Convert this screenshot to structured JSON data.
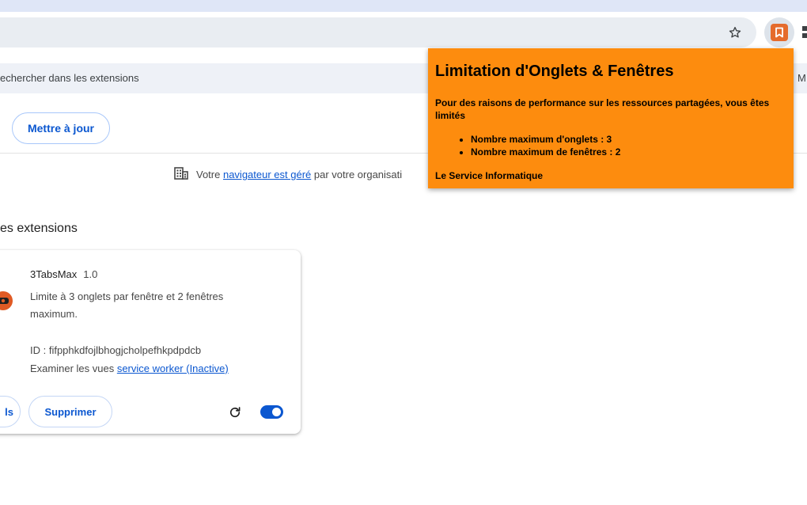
{
  "browser": {
    "bookmark_star_icon": "star-outline",
    "extension_icon": "bookmark-badge",
    "accent": "#0b57d0"
  },
  "extensions_page": {
    "search_placeholder": "echercher dans les extensions",
    "search_right_fragment": "M",
    "update_button": "Mettre à jour",
    "managed_notice": {
      "prefix": "Votre ",
      "link": "navigateur est géré",
      "suffix": " par votre organisati"
    },
    "section_title": "es extensions",
    "extension": {
      "name": "3TabsMax",
      "version": "1.0",
      "description": "Limite à 3 onglets par fenêtre et 2 fenêtres maximum.",
      "id_label": "ID : fifpphkdfojlbhogjcholpefhkpdpdcb",
      "views_prefix": "Examiner les vues ",
      "views_link": "service worker (Inactive)",
      "details_button": "ls",
      "remove_button": "Supprimer",
      "enabled": true
    }
  },
  "popup": {
    "background": "#fd8c0e",
    "title": "Limitation d'Onglets & Fenêtres",
    "message": "Pour des raisons de performance sur les ressources partagées, vous êtes limités",
    "limits": [
      "Nombre maximum d'onglets : 3",
      "Nombre maximum de fenêtres : 2"
    ],
    "signature": "Le Service Informatique"
  }
}
